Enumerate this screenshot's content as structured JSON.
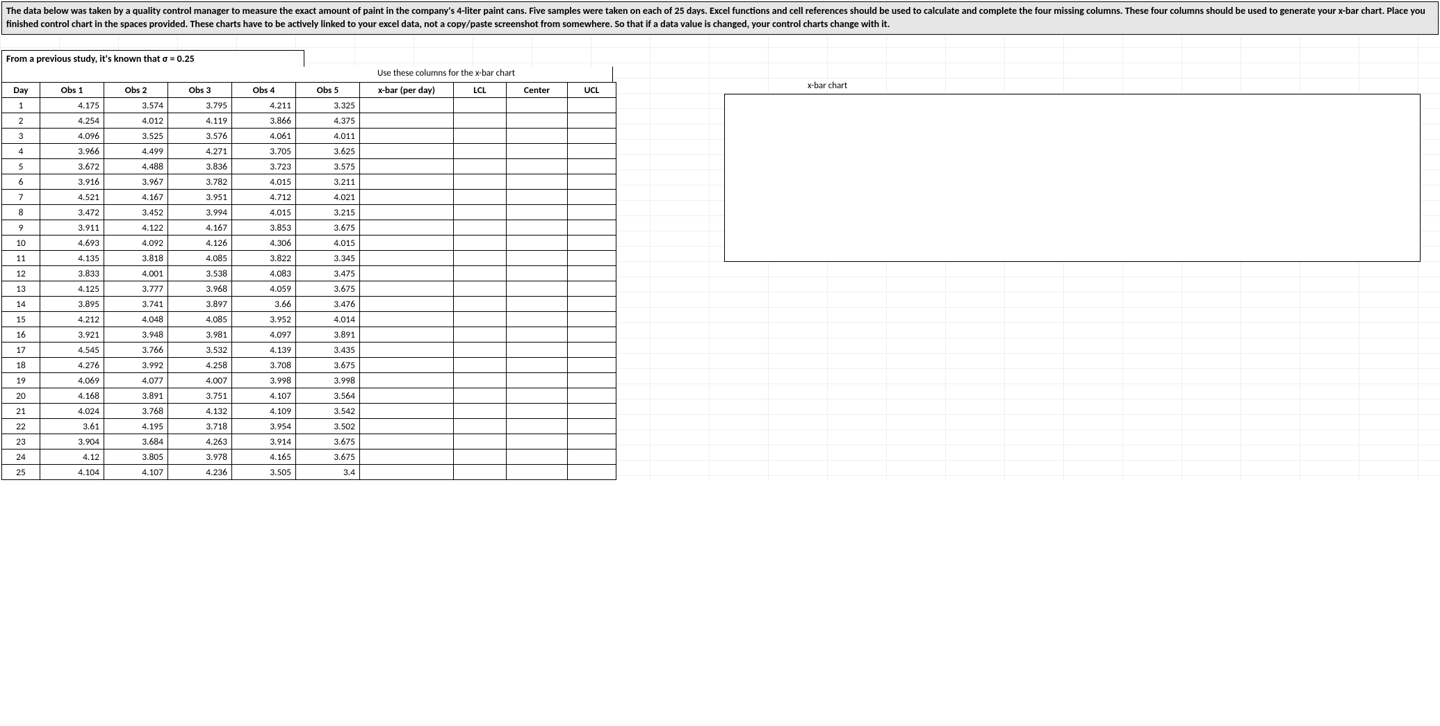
{
  "instructions": "The data below was taken by a quality control manager to measure the exact amount of paint in the company's 4-liter paint cans. Five samples were taken on each of 25 days.  Excel functions and cell references should be used to calculate and complete the four missing columns.  These four columns should be used to generate your x-bar chart. Place you finished control chart in the spaces provided. These charts have to be actively linked to your excel data, not a copy/paste screenshot from somewhere. So that if a data value is changed, your control charts change with it.",
  "sigma_note": "From a previous study, it's known that σ = 0.25",
  "use_cols_note": "Use these columns for the x-bar chart",
  "chart_label": "x-bar chart",
  "headers": {
    "day": "Day",
    "obs1": "Obs 1",
    "obs2": "Obs 2",
    "obs3": "Obs 3",
    "obs4": "Obs 4",
    "obs5": "Obs 5",
    "xbar": "x-bar (per day)",
    "lcl": "LCL",
    "center": "Center",
    "ucl": "UCL"
  },
  "rows": [
    {
      "day": "1",
      "o1": "4.175",
      "o2": "3.574",
      "o3": "3.795",
      "o4": "4.211",
      "o5": "3.325"
    },
    {
      "day": "2",
      "o1": "4.254",
      "o2": "4.012",
      "o3": "4.119",
      "o4": "3.866",
      "o5": "4.375"
    },
    {
      "day": "3",
      "o1": "4.096",
      "o2": "3.525",
      "o3": "3.576",
      "o4": "4.061",
      "o5": "4.011"
    },
    {
      "day": "4",
      "o1": "3.966",
      "o2": "4.499",
      "o3": "4.271",
      "o4": "3.705",
      "o5": "3.625"
    },
    {
      "day": "5",
      "o1": "3.672",
      "o2": "4.488",
      "o3": "3.836",
      "o4": "3.723",
      "o5": "3.575"
    },
    {
      "day": "6",
      "o1": "3.916",
      "o2": "3.967",
      "o3": "3.782",
      "o4": "4.015",
      "o5": "3.211"
    },
    {
      "day": "7",
      "o1": "4.521",
      "o2": "4.167",
      "o3": "3.951",
      "o4": "4.712",
      "o5": "4.021"
    },
    {
      "day": "8",
      "o1": "3.472",
      "o2": "3.452",
      "o3": "3.994",
      "o4": "4.015",
      "o5": "3.215"
    },
    {
      "day": "9",
      "o1": "3.911",
      "o2": "4.122",
      "o3": "4.167",
      "o4": "3.853",
      "o5": "3.675"
    },
    {
      "day": "10",
      "o1": "4.693",
      "o2": "4.092",
      "o3": "4.126",
      "o4": "4.306",
      "o5": "4.015"
    },
    {
      "day": "11",
      "o1": "4.135",
      "o2": "3.818",
      "o3": "4.085",
      "o4": "3.822",
      "o5": "3.345"
    },
    {
      "day": "12",
      "o1": "3.833",
      "o2": "4.001",
      "o3": "3.538",
      "o4": "4.083",
      "o5": "3.475"
    },
    {
      "day": "13",
      "o1": "4.125",
      "o2": "3.777",
      "o3": "3.968",
      "o4": "4.059",
      "o5": "3.675"
    },
    {
      "day": "14",
      "o1": "3.895",
      "o2": "3.741",
      "o3": "3.897",
      "o4": "3.66",
      "o5": "3.476"
    },
    {
      "day": "15",
      "o1": "4.212",
      "o2": "4.048",
      "o3": "4.085",
      "o4": "3.952",
      "o5": "4.014"
    },
    {
      "day": "16",
      "o1": "3.921",
      "o2": "3.948",
      "o3": "3.981",
      "o4": "4.097",
      "o5": "3.891"
    },
    {
      "day": "17",
      "o1": "4.545",
      "o2": "3.766",
      "o3": "3.532",
      "o4": "4.139",
      "o5": "3.435"
    },
    {
      "day": "18",
      "o1": "4.276",
      "o2": "3.992",
      "o3": "4.258",
      "o4": "3.708",
      "o5": "3.675"
    },
    {
      "day": "19",
      "o1": "4.069",
      "o2": "4.077",
      "o3": "4.007",
      "o4": "3.998",
      "o5": "3.998"
    },
    {
      "day": "20",
      "o1": "4.168",
      "o2": "3.891",
      "o3": "3.751",
      "o4": "4.107",
      "o5": "3.564"
    },
    {
      "day": "21",
      "o1": "4.024",
      "o2": "3.768",
      "o3": "4.132",
      "o4": "4.109",
      "o5": "3.542"
    },
    {
      "day": "22",
      "o1": "3.61",
      "o2": "4.195",
      "o3": "3.718",
      "o4": "3.954",
      "o5": "3.502"
    },
    {
      "day": "23",
      "o1": "3.904",
      "o2": "3.684",
      "o3": "4.263",
      "o4": "3.914",
      "o5": "3.675"
    },
    {
      "day": "24",
      "o1": "4.12",
      "o2": "3.805",
      "o3": "3.978",
      "o4": "4.165",
      "o5": "3.675"
    },
    {
      "day": "25",
      "o1": "4.104",
      "o2": "4.107",
      "o3": "4.236",
      "o4": "3.505",
      "o5": "3.4"
    }
  ]
}
